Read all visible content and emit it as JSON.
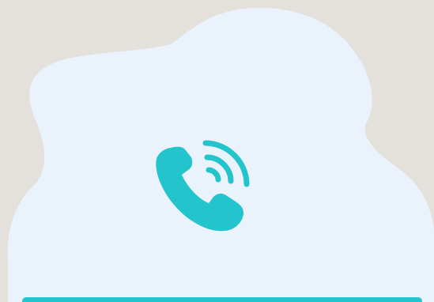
{
  "colors": {
    "background": "#e4e1dd",
    "blob": "#eaf3fb",
    "accent": "#23c4cb"
  },
  "icons": {
    "main": "phone-ringing-icon"
  },
  "bottom_bar": {
    "color": "#23c4cb"
  }
}
